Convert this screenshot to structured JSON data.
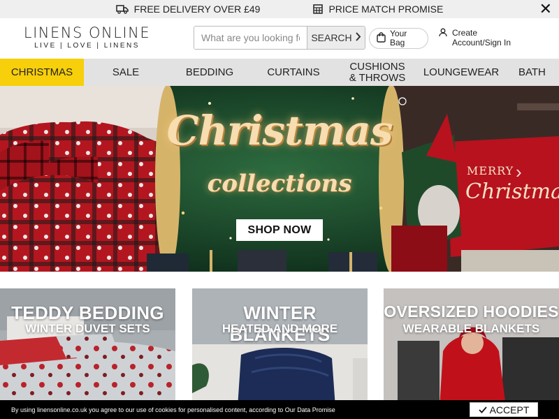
{
  "promo": {
    "delivery": "FREE DELIVERY OVER £49",
    "price_match": "PRICE MATCH PROMISE",
    "close_label": "✕"
  },
  "header": {
    "logo_main": "LINENS ONLINE",
    "logo_tagline": "LIVE | LOVE | LINENS",
    "search_placeholder": "What are you looking for?",
    "search_button": "SEARCH",
    "bag_label_line1": "Your",
    "bag_label_line2": "Bag",
    "account_line1": "Create",
    "account_line2": "Account/Sign In"
  },
  "nav": {
    "items": [
      "CHRISTMAS",
      "SALE",
      "BEDDING",
      "CURTAINS",
      "CUSHIONS & THROWS",
      "LOUNGEWEAR",
      "BATH"
    ],
    "active_index": 0
  },
  "hero": {
    "title": "Christmas",
    "subtitle": "collections",
    "cta": "SHOP NOW",
    "pillow_line1": "MERRY",
    "pillow_line2": "Christmas"
  },
  "tiles": [
    {
      "title": "TEDDY BEDDING",
      "subtitle": "WINTER DUVET SETS"
    },
    {
      "title": "WINTER BLANKETS",
      "subtitle": "HEATED AND MORE"
    },
    {
      "title": "OVERSIZED HOODIES",
      "subtitle": "WEARABLE BLANKETS"
    }
  ],
  "cookie": {
    "text": "By using linensonline.co.uk you agree to our use of cookies for personalised content, according to Our Data Promise",
    "accept": "ACCEPT"
  },
  "colors": {
    "nav_active": "#f7cf0a",
    "nav_bg": "#e2e2e2",
    "promo_bg": "#efefef",
    "hero_green": "#174026",
    "cookie_bg": "#000000"
  }
}
